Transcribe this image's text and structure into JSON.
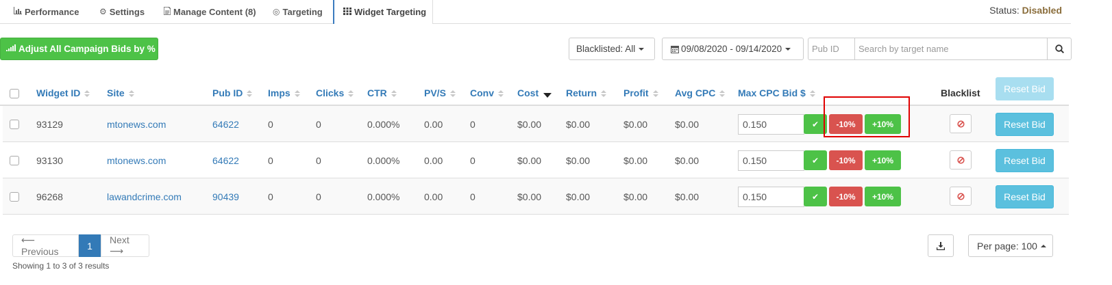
{
  "tabs": [
    {
      "label": "Performance",
      "icon": "bar-chart-icon"
    },
    {
      "label": "Settings",
      "icon": "gear-icon"
    },
    {
      "label": "Manage Content (8)",
      "icon": "document-icon"
    },
    {
      "label": "Targeting",
      "icon": "target-icon"
    },
    {
      "label": "Widget Targeting",
      "icon": "grid-icon",
      "active": true
    }
  ],
  "status": {
    "label": "Status:",
    "value": "Disabled",
    "value_color": "#8a6d3b"
  },
  "toolbar": {
    "adjust_label": "Adjust All Campaign Bids by %",
    "blacklisted_label": "Blacklisted: All",
    "date_range": "09/08/2020 - 09/14/2020",
    "pub_id_placeholder": "Pub ID",
    "search_placeholder": "Search by target name"
  },
  "table": {
    "columns": [
      "Widget ID",
      "Site",
      "Pub ID",
      "Imps",
      "Clicks",
      "CTR",
      "PV/S",
      "Conv",
      "Cost",
      "Return",
      "Profit",
      "Avg CPC",
      "Max CPC Bid $",
      "Blacklist"
    ],
    "reset_header": "Reset Bid",
    "minus_label": "-10%",
    "plus_label": "+10%",
    "reset_label": "Reset Bid",
    "rows": [
      {
        "widget_id": "93129",
        "site": "mtonews.com",
        "pub_id": "64622",
        "imps": "0",
        "clicks": "0",
        "ctr": "0.000%",
        "pvs": "0.00",
        "conv": "0",
        "cost": "$0.00",
        "return": "$0.00",
        "profit": "$0.00",
        "avg_cpc": "$0.00",
        "max_bid": "0.150"
      },
      {
        "widget_id": "93130",
        "site": "mtonews.com",
        "pub_id": "64622",
        "imps": "0",
        "clicks": "0",
        "ctr": "0.000%",
        "pvs": "0.00",
        "conv": "0",
        "cost": "$0.00",
        "return": "$0.00",
        "profit": "$0.00",
        "avg_cpc": "$0.00",
        "max_bid": "0.150"
      },
      {
        "widget_id": "96268",
        "site": "lawandcrime.com",
        "pub_id": "90439",
        "imps": "0",
        "clicks": "0",
        "ctr": "0.000%",
        "pvs": "0.00",
        "conv": "0",
        "cost": "$0.00",
        "return": "$0.00",
        "profit": "$0.00",
        "avg_cpc": "$0.00",
        "max_bid": "0.150"
      }
    ]
  },
  "pagination": {
    "previous": "⟵ Previous",
    "current": "1",
    "next": "Next ⟶",
    "showing": "Showing 1 to 3 of 3 results",
    "per_page": "Per page: 100"
  },
  "colors": {
    "accent": "#337ab7",
    "success": "#4dc247",
    "danger": "#d9534f",
    "info": "#5bc0de",
    "highlight": "#e00000"
  }
}
